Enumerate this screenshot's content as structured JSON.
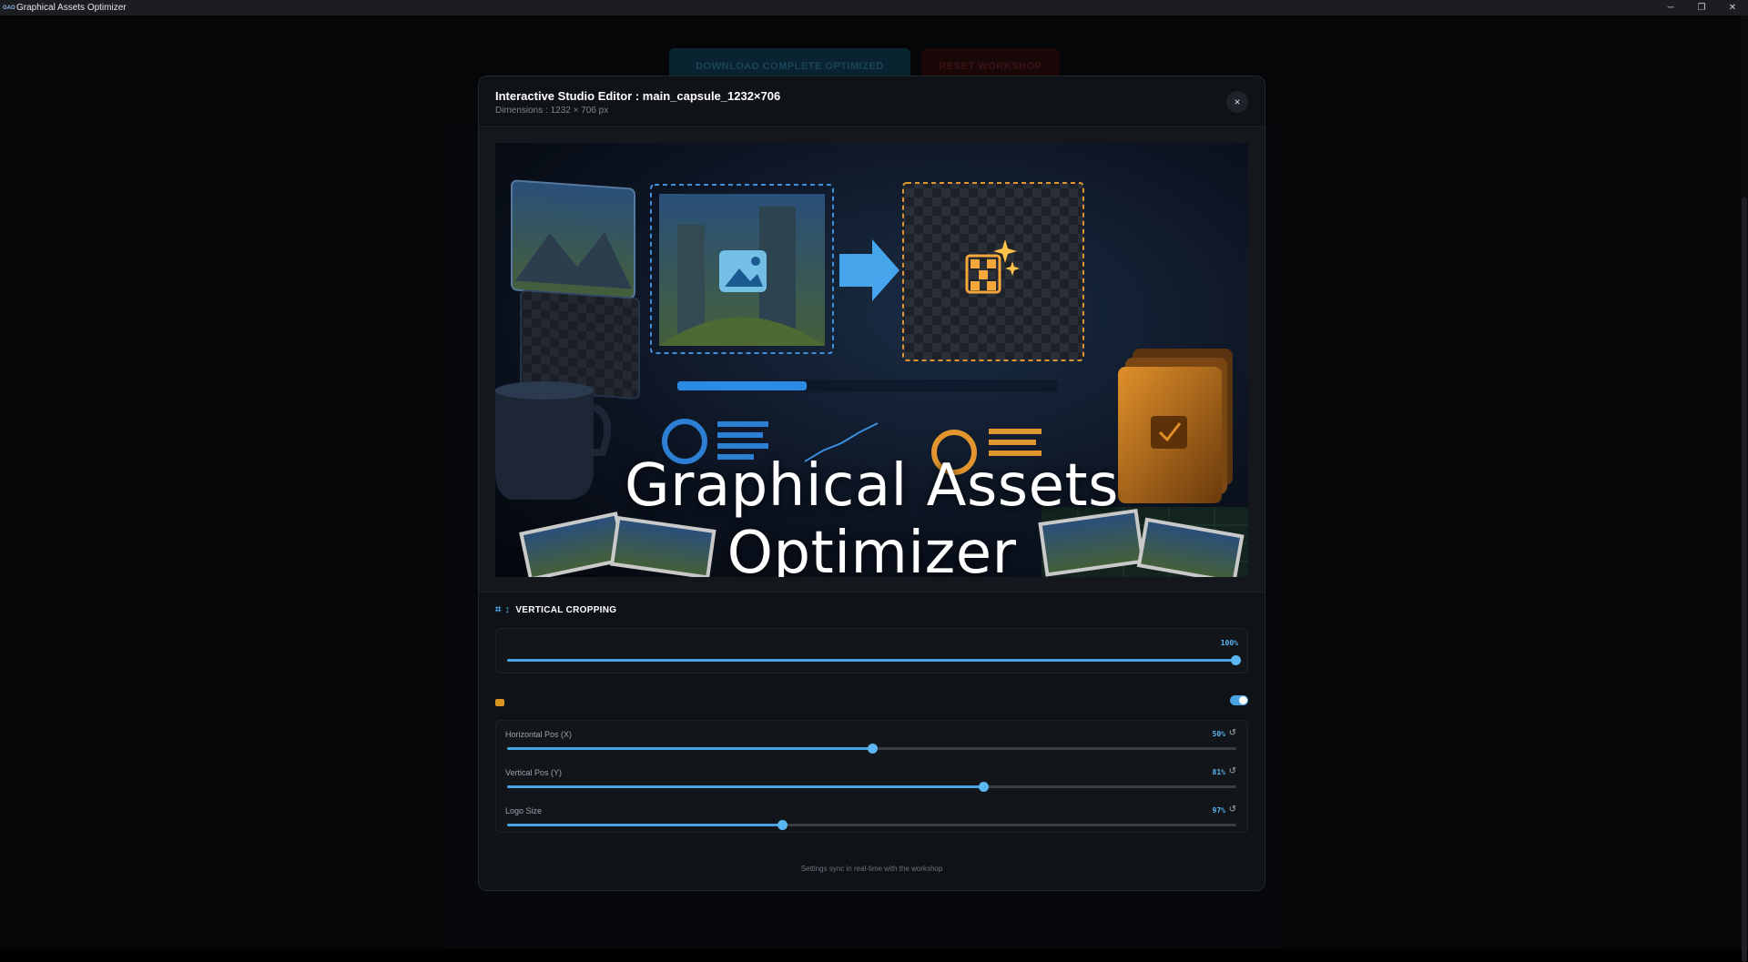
{
  "window": {
    "icon_text": "GAO",
    "title": "Graphical Assets Optimizer",
    "controls": {
      "minimize": "─",
      "maximize": "❐",
      "close": "✕"
    }
  },
  "background": {
    "primary_button": "DOWNLOAD COMPLETE OPTIMIZED",
    "danger_button": "RESET WORKSHOP"
  },
  "modal": {
    "title": "Interactive Studio Editor : main_capsule_1232×706",
    "subtitle": "Dimensions : 1232 × 706 px",
    "close_label": "×",
    "preview": {
      "capsule_title": "Graphical Assets Optimizer"
    },
    "vertical_cropping": {
      "label": "VERTICAL CROPPING",
      "value_text": "100%",
      "value": 1.0
    },
    "logo_overlay": {
      "enabled": true,
      "sliders": [
        {
          "label": "Horizontal Pos (X)",
          "value_text": "50%",
          "value": 0.5
        },
        {
          "label": "Vertical Pos (Y)",
          "value_text": "81%",
          "value": 0.653
        },
        {
          "label": "Logo Size",
          "value_text": "97%",
          "value": 0.377
        }
      ]
    },
    "footer_note": "Settings sync in real-time with the workshop"
  },
  "colors": {
    "accent": "#4aa3e2",
    "logo_accent": "#d89420",
    "modal_bg": "#0f1216"
  }
}
